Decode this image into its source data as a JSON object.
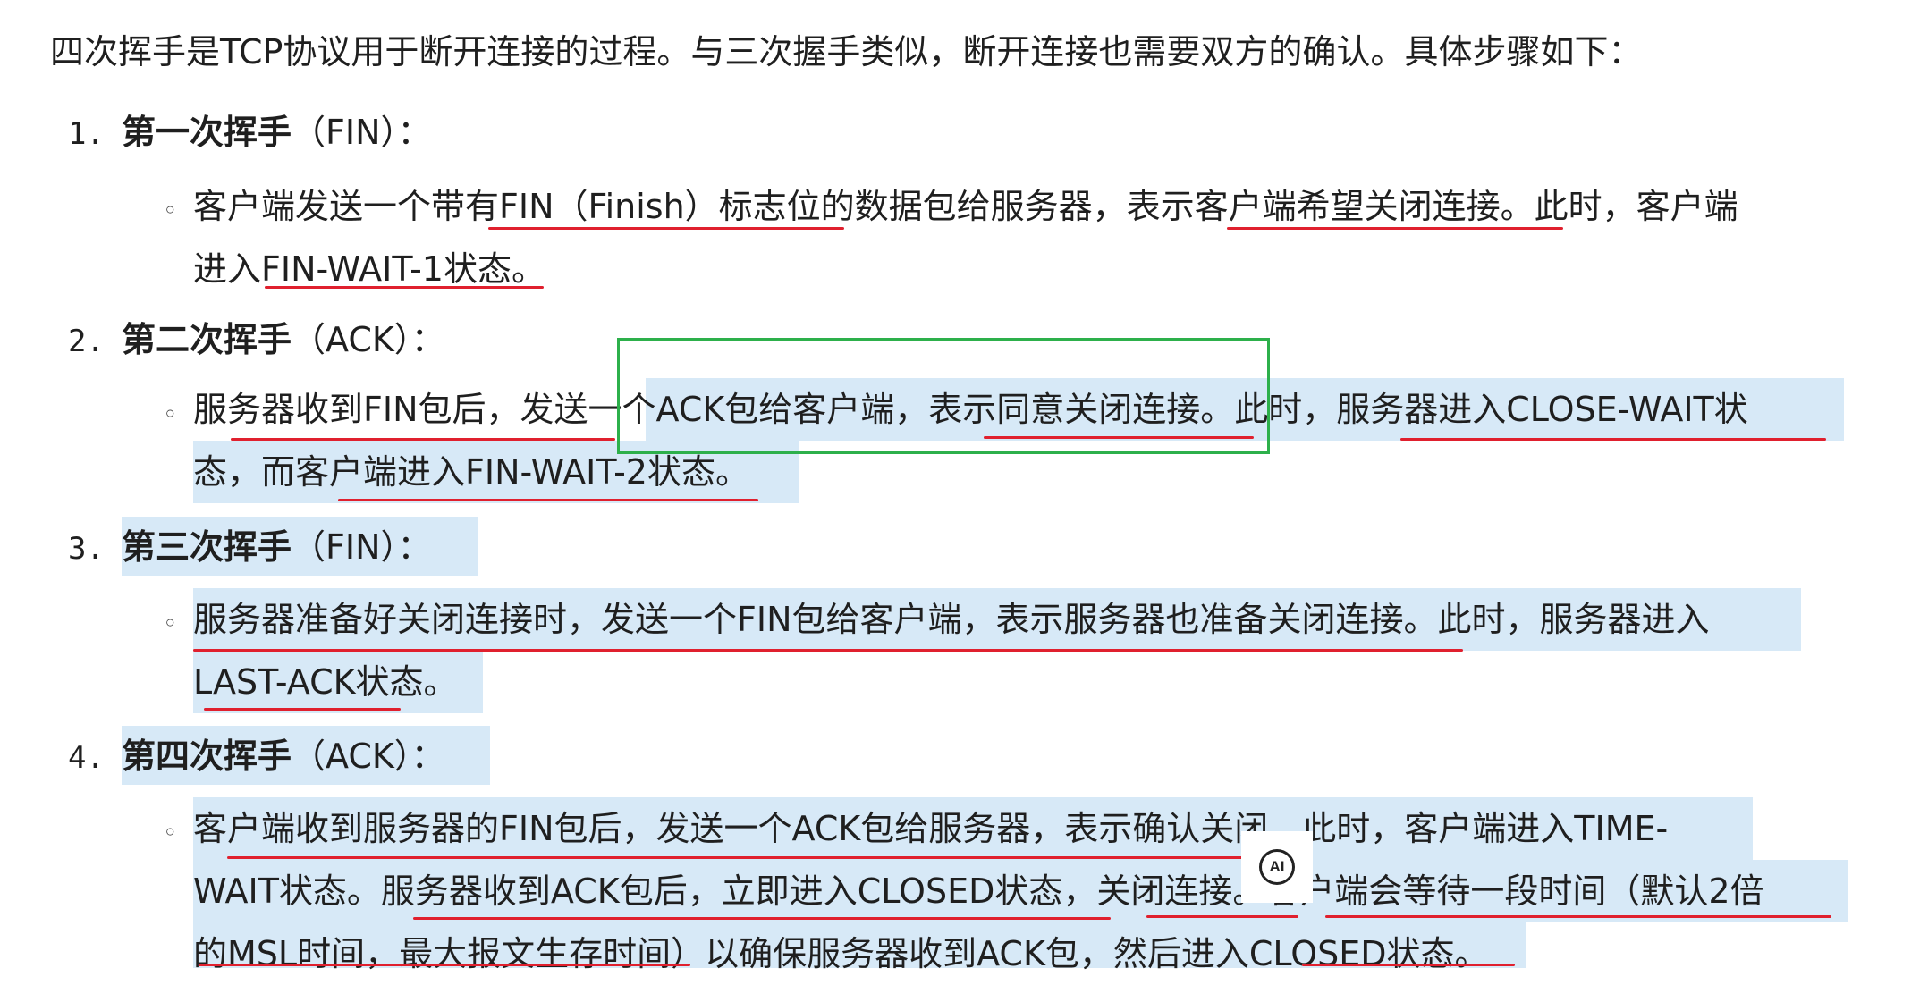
{
  "intro": "四次挥手是TCP协议用于断开连接的过程。与三次握手类似，断开连接也需要双方的确认。具体步骤如下：",
  "steps": [
    {
      "num": "1.",
      "title": "第一次挥手",
      "tag": "（FIN）：",
      "lines": [
        "客户端发送一个带有FIN（Finish）标志位的数据包给服务器，表示客户端希望关闭连接。此时，客户端",
        "进入FIN-WAIT-1状态。"
      ]
    },
    {
      "num": "2.",
      "title": "第二次挥手",
      "tag": "（ACK）：",
      "lines": [
        "服务器收到FIN包后，发送一个ACK包给客户端，表示同意关闭连接。此时，服务器进入CLOSE-WAIT状",
        "态，而客户端进入FIN-WAIT-2状态。"
      ]
    },
    {
      "num": "3.",
      "title": "第三次挥手",
      "tag": "（FIN）：",
      "lines": [
        "服务器准备好关闭连接时，发送一个FIN包给客户端，表示服务器也准备关闭连接。此时，服务器进入",
        "LAST-ACK状态。"
      ]
    },
    {
      "num": "4.",
      "title": "第四次挥手",
      "tag": "（ACK）：",
      "lines": [
        "客户端收到服务器的FIN包后，发送一个ACK包给服务器，表示确认关闭。此时，客户端进入TIME-",
        "WAIT状态。服务器收到ACK包后，立即进入CLOSED状态，关闭连接。客户端会等待一段时间（默认2倍",
        "的MSL时间，最大报文生存时间）以确保服务器收到ACK包，然后进入CLOSED状态。"
      ]
    }
  ],
  "bullet_symbol": "◦",
  "ai_badge": "AI",
  "colors": {
    "highlight": "#d7e9f7",
    "underline": "#e0202e",
    "box": "#2db04b"
  }
}
